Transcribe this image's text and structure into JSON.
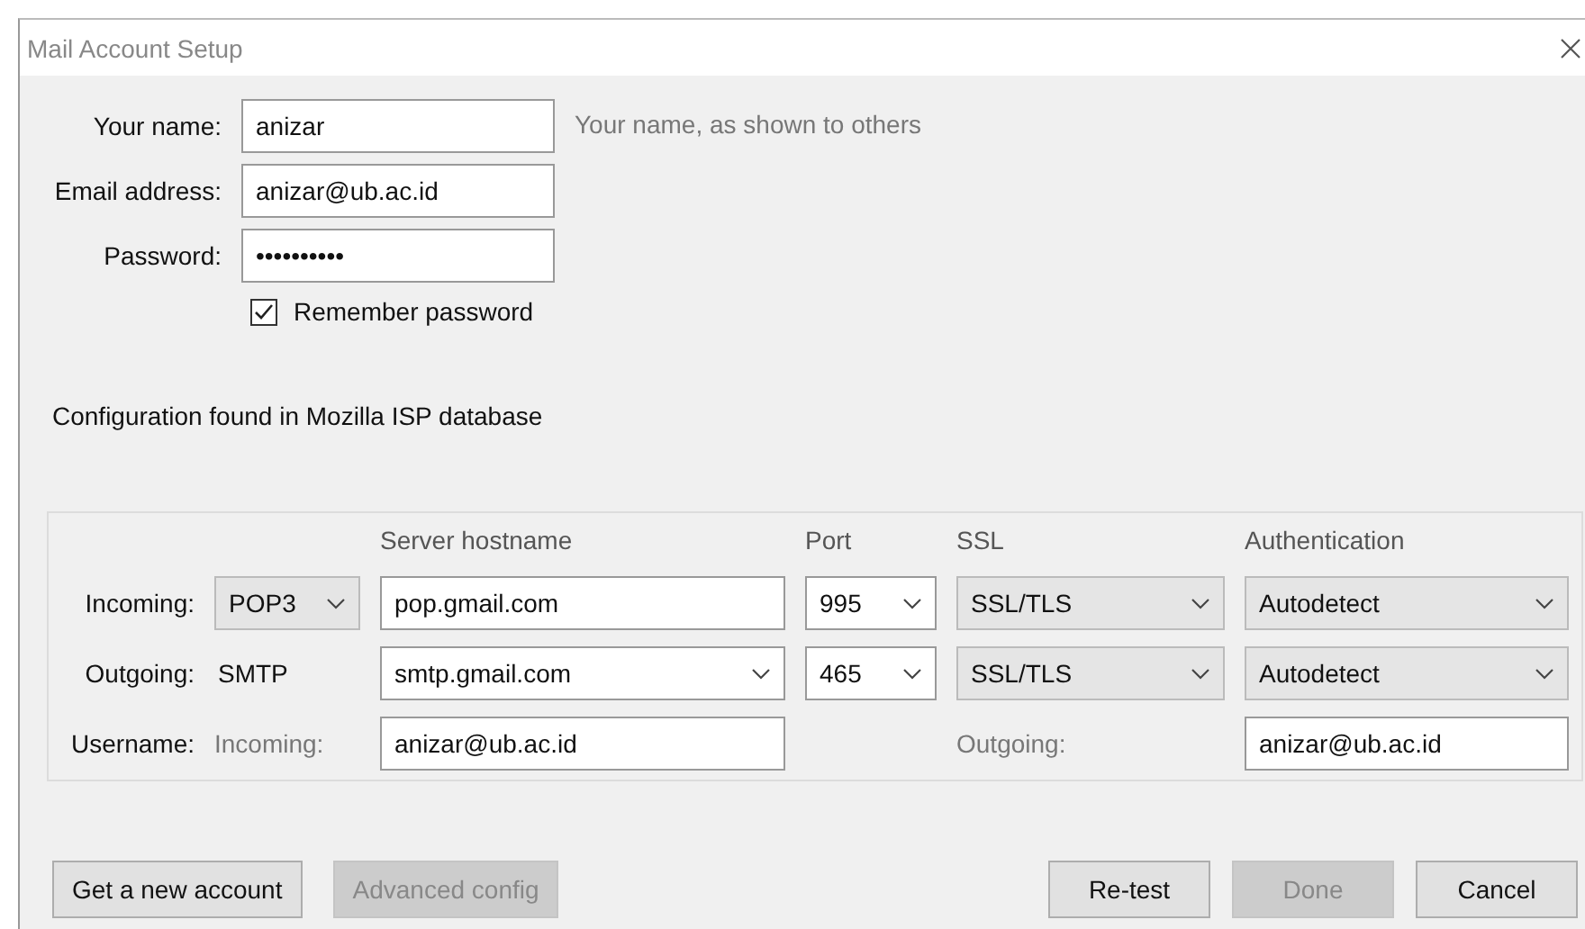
{
  "window": {
    "title": "Mail Account Setup"
  },
  "identity": [
    {
      "label": "Your name:",
      "value": "anizar",
      "hint": "Your name, as shown to others"
    },
    {
      "label": "Email address:",
      "value": "anizar@ub.ac.id"
    },
    {
      "label": "Password:",
      "value": "••••••••••"
    }
  ],
  "remember_password": {
    "label": "Remember password",
    "checked": true
  },
  "status": "Configuration found in Mozilla ISP database",
  "server": {
    "columns": [
      "",
      "",
      "Server hostname",
      "Port",
      "SSL",
      "Authentication"
    ],
    "rows": [
      {
        "cells": [
          {
            "kind": "label",
            "value": "Incoming:"
          },
          {
            "kind": "select",
            "value": "POP3"
          },
          {
            "kind": "text",
            "value": "pop.gmail.com"
          },
          {
            "kind": "combo",
            "value": "995"
          },
          {
            "kind": "select",
            "value": "SSL/TLS"
          },
          {
            "kind": "select",
            "value": "Autodetect"
          }
        ]
      },
      {
        "cells": [
          {
            "kind": "label",
            "value": "Outgoing:"
          },
          {
            "kind": "caption",
            "value": "SMTP"
          },
          {
            "kind": "combo",
            "value": "smtp.gmail.com"
          },
          {
            "kind": "combo",
            "value": "465"
          },
          {
            "kind": "select",
            "value": "SSL/TLS"
          },
          {
            "kind": "select",
            "value": "Autodetect"
          }
        ]
      },
      {
        "cells": [
          {
            "kind": "label",
            "value": "Username:"
          },
          {
            "kind": "muted",
            "value": "Incoming:"
          },
          {
            "kind": "text",
            "value": "anizar@ub.ac.id"
          },
          {
            "kind": "blank"
          },
          {
            "kind": "muted",
            "value": "Outgoing:"
          },
          {
            "kind": "text",
            "value": "anizar@ub.ac.id"
          }
        ]
      }
    ]
  },
  "left_buttons": [
    {
      "label": "Get a new account",
      "disabled": false
    },
    {
      "label": "Advanced config",
      "disabled": true
    }
  ],
  "right_buttons": [
    {
      "label": "Re-test",
      "disabled": false
    },
    {
      "label": "Done",
      "disabled": true
    },
    {
      "label": "Cancel",
      "disabled": false
    }
  ]
}
